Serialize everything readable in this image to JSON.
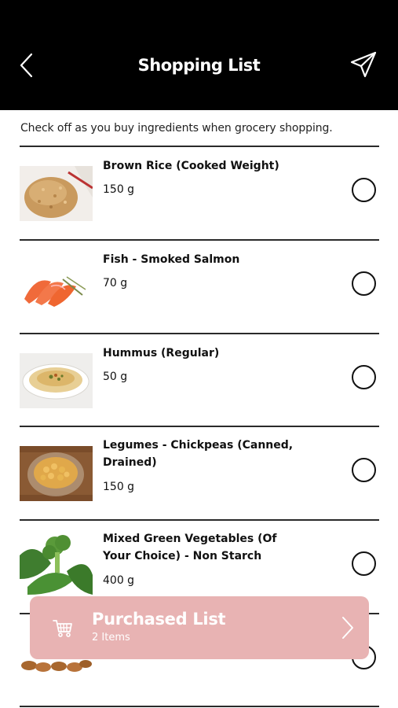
{
  "header": {
    "title": "Shopping List",
    "back_icon": "chevron-left-icon",
    "send_icon": "paper-plane-icon"
  },
  "instructions": "Check off as you buy ingredients when grocery shopping.",
  "items": [
    {
      "name": "Brown Rice (Cooked Weight)",
      "quantity": "150 g",
      "checked": false,
      "image": "brown-rice"
    },
    {
      "name": "Fish - Smoked Salmon",
      "quantity": "70 g",
      "checked": false,
      "image": "smoked-salmon"
    },
    {
      "name": "Hummus (Regular)",
      "quantity": "50 g",
      "checked": false,
      "image": "hummus"
    },
    {
      "name": "Legumes - Chickpeas (Canned, Drained)",
      "quantity": "150 g",
      "checked": false,
      "image": "chickpeas"
    },
    {
      "name": "Mixed Green Vegetables (Of Your Choice) - Non Starch",
      "quantity": "400 g",
      "checked": false,
      "image": "green-vegetables"
    },
    {
      "name": "",
      "quantity": "",
      "checked": false,
      "image": "almonds"
    }
  ],
  "purchased": {
    "title": "Purchased List",
    "count": "2 Items",
    "icon": "cart-icon",
    "color": "#e8b3b3"
  }
}
